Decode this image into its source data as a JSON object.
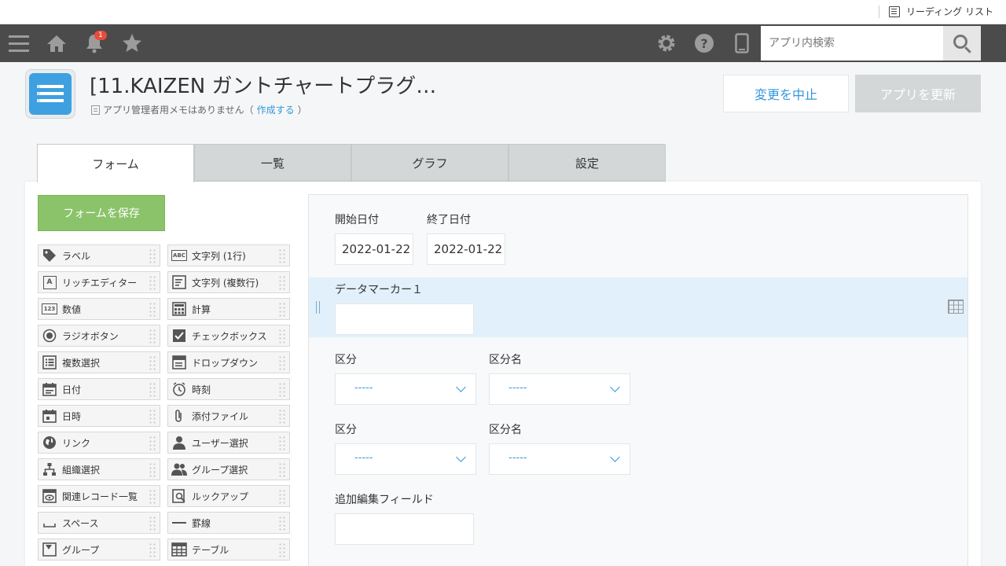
{
  "browser": {
    "reading_list": "リーディング リスト"
  },
  "header": {
    "notification_count": "1",
    "search": {
      "placeholder": "アプリ内検索"
    },
    "icons": [
      "menu-icon",
      "home-icon",
      "bell-icon",
      "star-icon",
      "gear-icon",
      "help-icon",
      "mobile-icon",
      "search-icon"
    ]
  },
  "app": {
    "title": "[11.KAIZEN ガントチャートプラグ…",
    "memo_text": "アプリ管理者用メモはありません（",
    "memo_link": "作成する",
    "memo_close": "）",
    "cancel_label": "変更を中止",
    "update_label": "アプリを更新"
  },
  "tabs": [
    {
      "label": "フォーム",
      "active": true
    },
    {
      "label": "一覧",
      "active": false
    },
    {
      "label": "グラフ",
      "active": false
    },
    {
      "label": "設定",
      "active": false
    }
  ],
  "save_form_label": "フォームを保存",
  "palette": [
    {
      "label": "ラベル",
      "icon": "tag-icon"
    },
    {
      "label": "文字列 (1行)",
      "icon": "abc-icon"
    },
    {
      "label": "リッチエディター",
      "icon": "rich-editor-icon"
    },
    {
      "label": "文字列 (複数行)",
      "icon": "multiline-icon"
    },
    {
      "label": "数値",
      "icon": "number-icon"
    },
    {
      "label": "計算",
      "icon": "calculator-icon"
    },
    {
      "label": "ラジオボタン",
      "icon": "radio-icon"
    },
    {
      "label": "チェックボックス",
      "icon": "checkbox-icon"
    },
    {
      "label": "複数選択",
      "icon": "multi-select-icon"
    },
    {
      "label": "ドロップダウン",
      "icon": "dropdown-icon"
    },
    {
      "label": "日付",
      "icon": "calendar-icon"
    },
    {
      "label": "時刻",
      "icon": "clock-icon"
    },
    {
      "label": "日時",
      "icon": "datetime-icon"
    },
    {
      "label": "添付ファイル",
      "icon": "paperclip-icon"
    },
    {
      "label": "リンク",
      "icon": "globe-icon"
    },
    {
      "label": "ユーザー選択",
      "icon": "user-icon"
    },
    {
      "label": "組織選択",
      "icon": "org-icon"
    },
    {
      "label": "グループ選択",
      "icon": "group-icon"
    },
    {
      "label": "関連レコード一覧",
      "icon": "related-records-icon"
    },
    {
      "label": "ルックアップ",
      "icon": "lookup-icon"
    },
    {
      "label": "スペース",
      "icon": "space-icon"
    },
    {
      "label": "罫線",
      "icon": "line-icon"
    },
    {
      "label": "グループ",
      "icon": "group-field-icon"
    },
    {
      "label": "テーブル",
      "icon": "table-icon"
    }
  ],
  "form": {
    "start_date_label": "開始日付",
    "start_date_value": "2022-01-22",
    "end_date_label": "終了日付",
    "end_date_value": "2022-01-22",
    "data_marker_label": "データマーカー１",
    "kubun1_label": "区分",
    "kubun1_value": "-----",
    "kubun1_name_label": "区分名",
    "kubun1_name_value": "-----",
    "kubun2_label": "区分",
    "kubun2_value": "-----",
    "kubun2_name_label": "区分名",
    "kubun2_name_value": "-----",
    "extra_field_label": "追加編集フィールド"
  }
}
